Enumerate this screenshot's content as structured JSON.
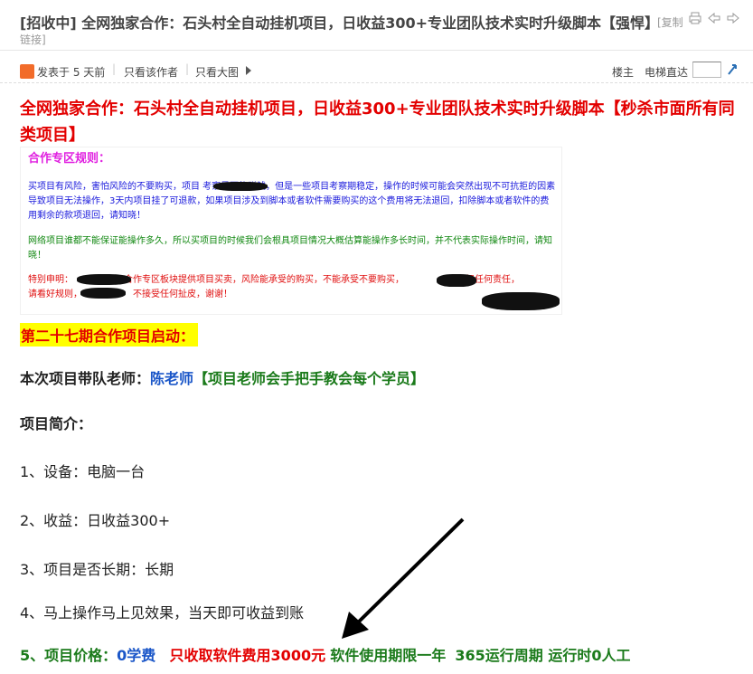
{
  "thread": {
    "tag": "[招收中]",
    "title": "全网独家合作：石头村全自动挂机项目，日收益300+专业团队技术实时升级脚本【强悍】",
    "copy_label": "[复制",
    "link_label": "链接]"
  },
  "meta": {
    "posted": "发表于 5 天前",
    "author_only": "只看该作者",
    "big_only": "只看大图",
    "floor_host": "楼主",
    "elevator": "电梯直达",
    "floor_input_value": ""
  },
  "post": {
    "big_title": "全网独家合作：石头村全自动挂机项目，日收益300+专业团队技术实时升级脚本【秒杀市面所有同类项目】",
    "rules": {
      "heading": "合作专区规则：",
      "p1": "买项目有风险，害怕风险的不要购买，项目              考察是否能赚钱，但是一些项目考察期稳定，操作的时候可能会突然出现不可抗拒的因素导致项目无法操作，3天内项目挂了可退款，如果项目涉及到脚本或者软件需要购买的这个费用将无法退回，扣除脚本或者软件的费用剩余的款项退回，请知晓！",
      "p2": "网络项目谁都不能保证能操作多久，所以买项目的时候我们会根具项目情况大概估算能操作多长时间，并不代表实际操作时间，请知晓！",
      "p3a": "特别申明：",
      "p3b": "合作专区板块提供项目买卖，风险能承受的购买，不能承受不要购买，",
      "p3c": "不承担任何责任，",
      "p3d": "请看好规则，",
      "p3e": "不接受任何扯皮，谢谢！"
    },
    "period": "第二十七期合作项目启动：",
    "teacher_label": "本次项目带队老师：",
    "teacher_name": "陈老师",
    "teacher_note": "【项目老师会手把手教会每个学员】",
    "intro_heading": "项目简介：",
    "item1": "1、设备：电脑一台",
    "item2": "2、收益：日收益300+",
    "item3": "3、项目是否长期：长期",
    "item4": "4、马上操作马上见效果，当天即可收益到账",
    "price_label": "5、项目价格：",
    "price_free": "0学费",
    "price_fee": "只收取软件费用3000元",
    "price_term": "软件使用期限一年",
    "price_cycle": "365运行周期 运行时0人工"
  },
  "icons": [
    "user-avatar-icon",
    "triangle-right-icon",
    "print-icon",
    "prev-icon",
    "next-icon",
    "go-icon"
  ],
  "colors": {
    "title_red": "#e30000",
    "blue": "#1a56c8",
    "green": "#1a7a1a",
    "highlight": "#ffff00"
  }
}
